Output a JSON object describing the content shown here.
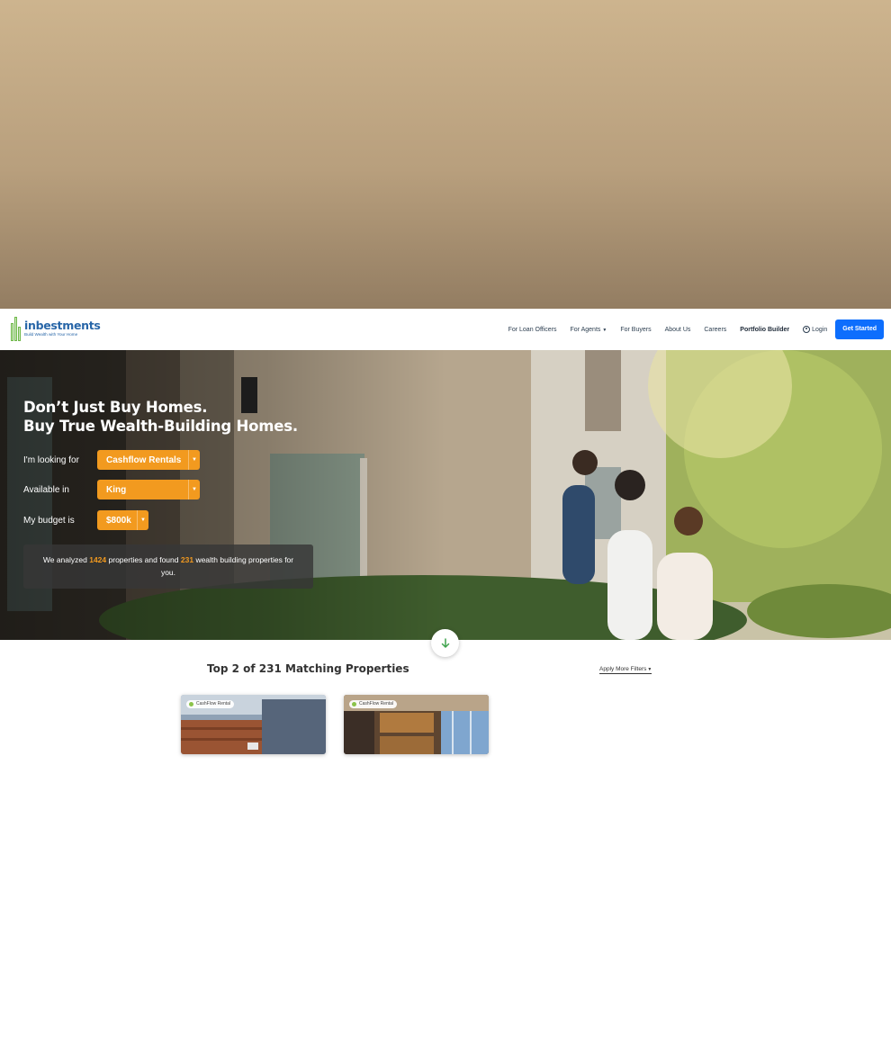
{
  "logo": {
    "name": "inbestments",
    "tagline": "Build Wealth with Your Home"
  },
  "nav": {
    "items": [
      {
        "label": "For Loan Officers"
      },
      {
        "label": "For Agents",
        "has_dropdown": true
      },
      {
        "label": "For Buyers"
      },
      {
        "label": "About Us"
      },
      {
        "label": "Careers"
      },
      {
        "label": "Portfolio Builder"
      },
      {
        "label": "Login",
        "icon": "user-circle-icon"
      }
    ],
    "cta": "Get Started"
  },
  "hero": {
    "headline_line1": "Don’t Just Buy Homes.",
    "headline_line2": "Buy True Wealth-Building Homes.",
    "filters": [
      {
        "label": "I'm looking for",
        "value": "Cashflow Rentals"
      },
      {
        "label": "Available in",
        "value": "King"
      },
      {
        "label": "My budget is",
        "value": "$800k"
      }
    ],
    "result": {
      "prefix": "We analyzed",
      "analyzed": "1424",
      "middle": "properties and found",
      "found": "231",
      "suffix": "wealth building properties for you."
    }
  },
  "results": {
    "title": "Top 2 of 231 Matching Properties",
    "filters_link": "Apply More Filters",
    "cards": [
      {
        "badge": "CashFlow Rental"
      },
      {
        "badge": "CashFlow Rental"
      }
    ]
  },
  "colors": {
    "accent": "#f29a1f",
    "primary": "#0d6efd",
    "brand": "#2866a8",
    "badge_dot": "#8bc34a"
  }
}
